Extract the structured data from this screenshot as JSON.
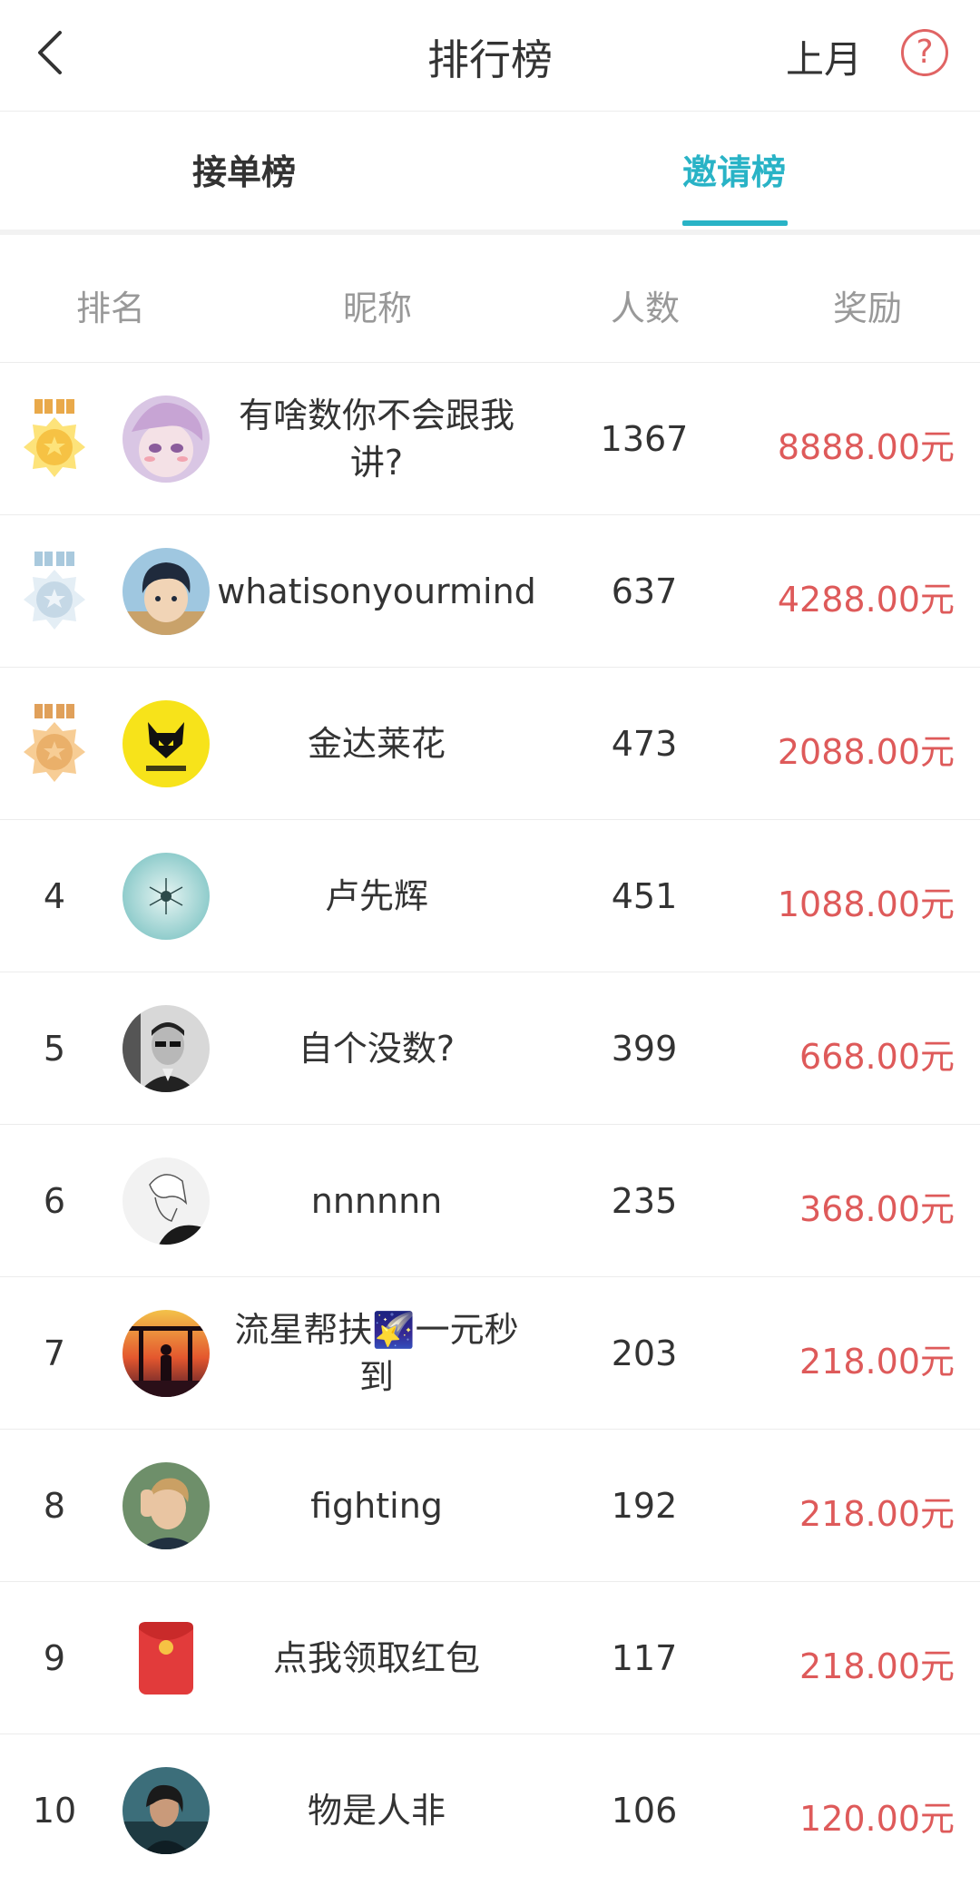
{
  "header": {
    "title": "排行榜",
    "month_label": "上月",
    "help_symbol": "?"
  },
  "tabs": [
    {
      "label": "接单榜",
      "active": false
    },
    {
      "label": "邀请榜",
      "active": true
    }
  ],
  "accent_color": "#29b3c6",
  "reward_color": "#de5a5a",
  "columns": {
    "rank": "排名",
    "nickname": "昵称",
    "count": "人数",
    "reward": "奖励"
  },
  "rows": [
    {
      "rank": "1",
      "medal": "gold",
      "avatar": "anime-girl-avatar",
      "nickname": "有啥数你不会跟我讲?",
      "count": "1367",
      "reward": "8888.00元"
    },
    {
      "rank": "2",
      "medal": "silver",
      "avatar": "anime-boy-avatar",
      "nickname": "whatisonyourmind",
      "count": "637",
      "reward": "4288.00元"
    },
    {
      "rank": "3",
      "medal": "bronze",
      "avatar": "kind-fox-logo-avatar",
      "nickname": "金达莱花",
      "count": "473",
      "reward": "2088.00元"
    },
    {
      "rank": "4",
      "medal": null,
      "avatar": "dandelion-avatar",
      "nickname": "卢先辉",
      "count": "451",
      "reward": "1088.00元"
    },
    {
      "rank": "5",
      "medal": null,
      "avatar": "man-sunglasses-avatar",
      "nickname": "自个没数?",
      "count": "399",
      "reward": "668.00元"
    },
    {
      "rank": "6",
      "medal": null,
      "avatar": "sketch-portrait-avatar",
      "nickname": "nnnnnn",
      "count": "235",
      "reward": "368.00元"
    },
    {
      "rank": "7",
      "medal": null,
      "avatar": "sunset-silhouette-avatar",
      "nickname": "流星帮扶🌠一元秒到",
      "count": "203",
      "reward": "218.00元"
    },
    {
      "rank": "8",
      "medal": null,
      "avatar": "young-man-avatar",
      "nickname": "fighting",
      "count": "192",
      "reward": "218.00元"
    },
    {
      "rank": "9",
      "medal": null,
      "avatar": "red-envelope-avatar",
      "nickname": "点我领取红包",
      "count": "117",
      "reward": "218.00元"
    },
    {
      "rank": "10",
      "medal": null,
      "avatar": "singer-photo-avatar",
      "nickname": "物是人非",
      "count": "106",
      "reward": "120.00元"
    }
  ]
}
